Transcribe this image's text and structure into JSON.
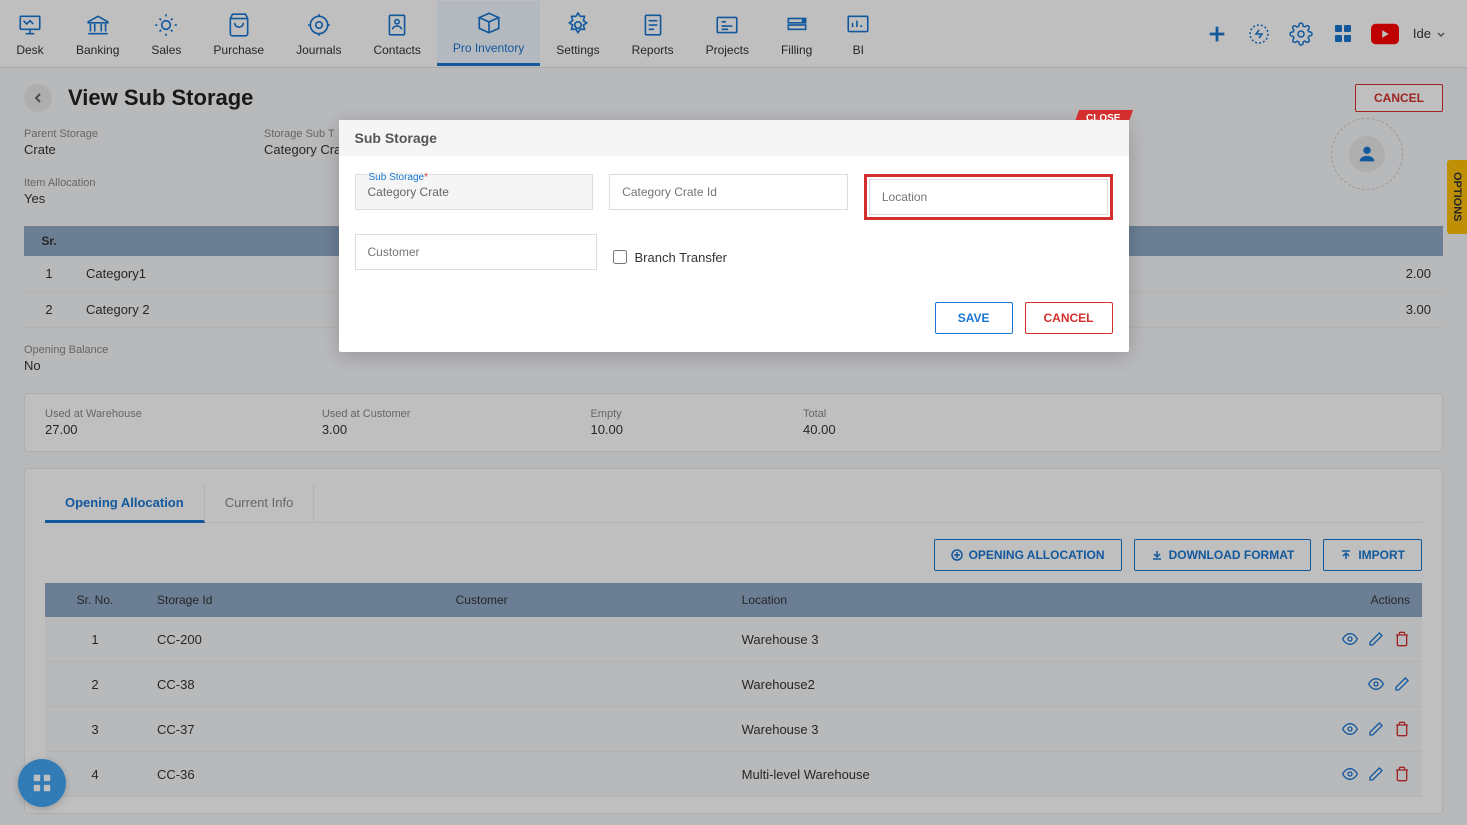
{
  "nav": {
    "items": [
      {
        "label": "Desk"
      },
      {
        "label": "Banking"
      },
      {
        "label": "Sales"
      },
      {
        "label": "Purchase"
      },
      {
        "label": "Journals"
      },
      {
        "label": "Contacts"
      },
      {
        "label": "Pro Inventory"
      },
      {
        "label": "Settings"
      },
      {
        "label": "Reports"
      },
      {
        "label": "Projects"
      },
      {
        "label": "Filling"
      },
      {
        "label": "BI"
      }
    ],
    "user": "Ide"
  },
  "header": {
    "title": "View Sub Storage",
    "cancel": "CANCEL"
  },
  "info": {
    "parent_storage_label": "Parent Storage",
    "parent_storage_value": "Crate",
    "sub_type_label": "Storage Sub T",
    "sub_type_value": "Category Crate",
    "item_allocation_label": "Item Allocation",
    "item_allocation_value": "Yes",
    "opening_balance_label": "Opening Balance",
    "opening_balance_value": "No"
  },
  "cat_table": {
    "headers": {
      "sr": "Sr.",
      "name": "",
      "qty": ""
    },
    "rows": [
      {
        "sr": "1",
        "name": "Category1",
        "qty": "2.00"
      },
      {
        "sr": "2",
        "name": "Category 2",
        "qty": "3.00"
      }
    ]
  },
  "stats": {
    "used_warehouse_label": "Used at Warehouse",
    "used_warehouse_value": "27.00",
    "used_customer_label": "Used at Customer",
    "used_customer_value": "3.00",
    "empty_label": "Empty",
    "empty_value": "10.00",
    "total_label": "Total",
    "total_value": "40.00"
  },
  "tabs": {
    "opening": "Opening Allocation",
    "current": "Current Info"
  },
  "action_buttons": {
    "opening_allocation": "OPENING ALLOCATION",
    "download_format": "DOWNLOAD FORMAT",
    "import": "IMPORT"
  },
  "alloc_table": {
    "headers": {
      "sr": "Sr. No.",
      "storage_id": "Storage Id",
      "customer": "Customer",
      "location": "Location",
      "actions": "Actions"
    },
    "rows": [
      {
        "sr": "1",
        "storage_id": "CC-200",
        "customer": "",
        "location": "Warehouse 3",
        "has_delete": true
      },
      {
        "sr": "2",
        "storage_id": "CC-38",
        "customer": "",
        "location": "Warehouse2",
        "has_delete": false
      },
      {
        "sr": "3",
        "storage_id": "CC-37",
        "customer": "",
        "location": "Warehouse 3",
        "has_delete": true
      },
      {
        "sr": "4",
        "storage_id": "CC-36",
        "customer": "",
        "location": "Multi-level Warehouse",
        "has_delete": true
      }
    ]
  },
  "modal": {
    "title": "Sub Storage",
    "close": "CLOSE",
    "sub_storage_label": "Sub Storage",
    "sub_storage_value": "Category Crate",
    "crate_id_placeholder": "Category Crate Id",
    "location_placeholder": "Location",
    "customer_placeholder": "Customer",
    "branch_transfer": "Branch Transfer",
    "save": "SAVE",
    "cancel": "CANCEL"
  },
  "options": "OPTIONS"
}
